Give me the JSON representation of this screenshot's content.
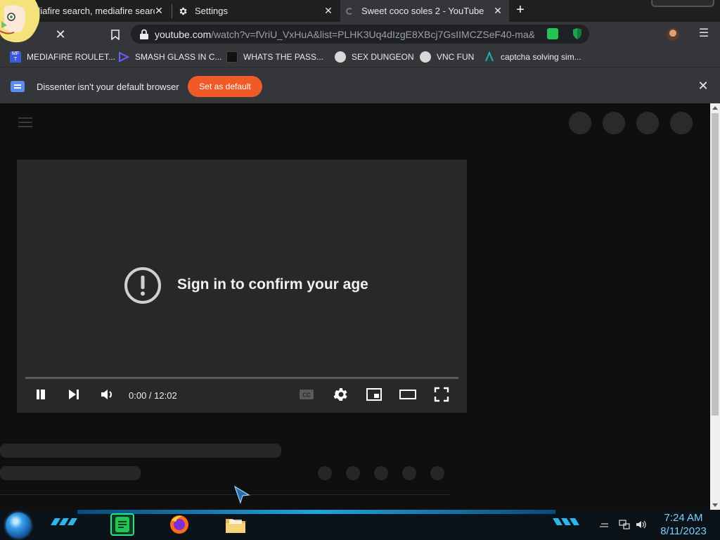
{
  "tabs": [
    {
      "title": "diafire search, mediafire search",
      "active": false
    },
    {
      "title": "Settings",
      "active": false
    },
    {
      "title": "Sweet coco soles 2 - YouTube",
      "active": true
    }
  ],
  "toolbar": {
    "url_host": "youtube.com",
    "url_rest": "/watch?v=fVriU_VxHuA&list=PLHK3Uq4dIzgE8XBcj7GsIIMCZSeF40-ma&..."
  },
  "bookmarks": [
    {
      "label": "MEDIAFIRE ROULET...",
      "icon": "mediafire-roulette-icon",
      "color": "#3b5bdb"
    },
    {
      "label": "SMASH GLASS IN C...",
      "icon": "smash-glass-icon",
      "color": "#5b3fd6"
    },
    {
      "label": "WHATS THE PASS...",
      "icon": "whats-the-pass-icon",
      "color": "#111111"
    },
    {
      "label": "SEX DUNGEON",
      "icon": "sex-dungeon-icon",
      "color": "#777777"
    },
    {
      "label": "VNC FUN",
      "icon": "vnc-fun-icon",
      "color": "#777777"
    },
    {
      "label": "captcha solving sim...",
      "icon": "captcha-solving-icon",
      "color": "#20b2aa"
    }
  ],
  "infobar": {
    "message": "Dissenter isn't your default browser",
    "button": "Set as default",
    "accent": "#f05a28"
  },
  "player": {
    "message": "Sign in to confirm your age",
    "time": "0:00 / 12:02",
    "progress": 0
  },
  "taskbar": {
    "time": "7:24 AM",
    "date": "8/11/2023"
  }
}
